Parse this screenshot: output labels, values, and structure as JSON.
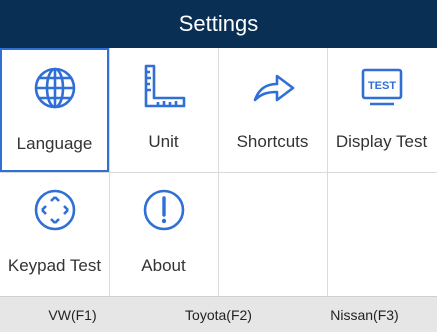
{
  "header": {
    "title": "Settings"
  },
  "tiles": [
    {
      "label": "Language",
      "icon": "globe-icon",
      "selected": true
    },
    {
      "label": "Unit",
      "icon": "ruler-icon"
    },
    {
      "label": "Shortcuts",
      "icon": "arrow-right-icon"
    },
    {
      "label": "Display Test",
      "icon": "test-display-icon",
      "icon_text": "TEST"
    },
    {
      "label": "Keypad Test",
      "icon": "dpad-icon"
    },
    {
      "label": "About",
      "icon": "info-exclamation-icon"
    }
  ],
  "footer": {
    "keys": [
      {
        "label": "VW(F1)"
      },
      {
        "label": "Toyota(F2)"
      },
      {
        "label": "Nissan(F3)"
      }
    ]
  },
  "colors": {
    "title_bar": "#0a2f55",
    "icon_accent": "#2f6fd6",
    "footer_bg": "#e6e6e6"
  }
}
